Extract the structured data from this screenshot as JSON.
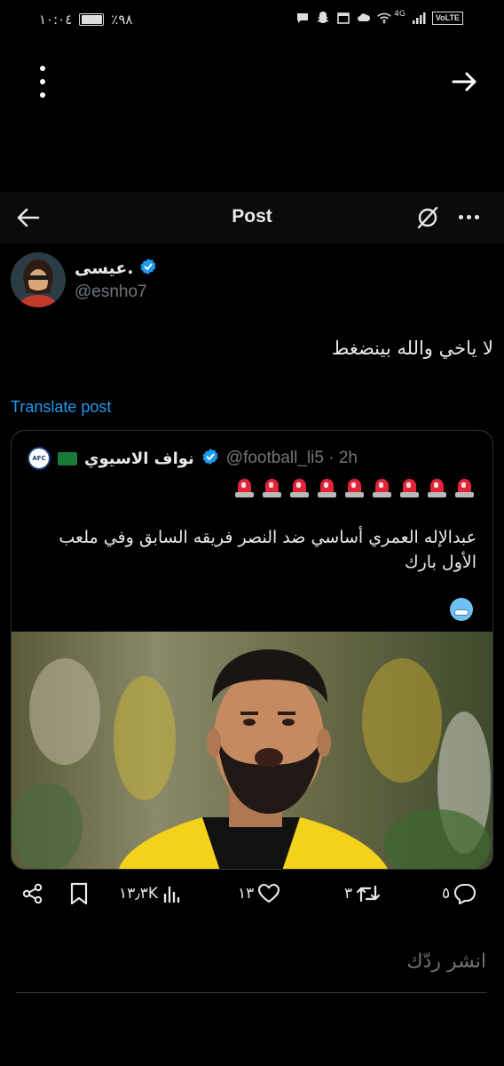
{
  "status_bar": {
    "time": "١٠:٠٤",
    "battery_text": "٪٩٨",
    "battery_level": 0.98,
    "network_label": "4G",
    "volte_label": "VoLTE"
  },
  "header": {
    "title": "Post"
  },
  "post": {
    "author_name": "عيسى.",
    "author_handle": "@esnho7",
    "text": "لا ياخي والله بينضغط",
    "translate_label": "Translate post"
  },
  "quote": {
    "logo_text": "AFC",
    "name": "نواف الاسيوي",
    "handle_time": "@football_li5 · 2h",
    "siren_count": 9,
    "text": "عبدالإله العمري أساسي ضد النصر فريقه السابق وفي ملعب الأول بارك"
  },
  "actions": {
    "replies": "٥",
    "reposts": "٣",
    "likes": "١٣",
    "views": "١٣٫٣K"
  },
  "reply": {
    "placeholder": "انشر ردّك"
  },
  "colors": {
    "accent": "#1d9bf0",
    "background": "#000000",
    "muted": "#71767b"
  }
}
